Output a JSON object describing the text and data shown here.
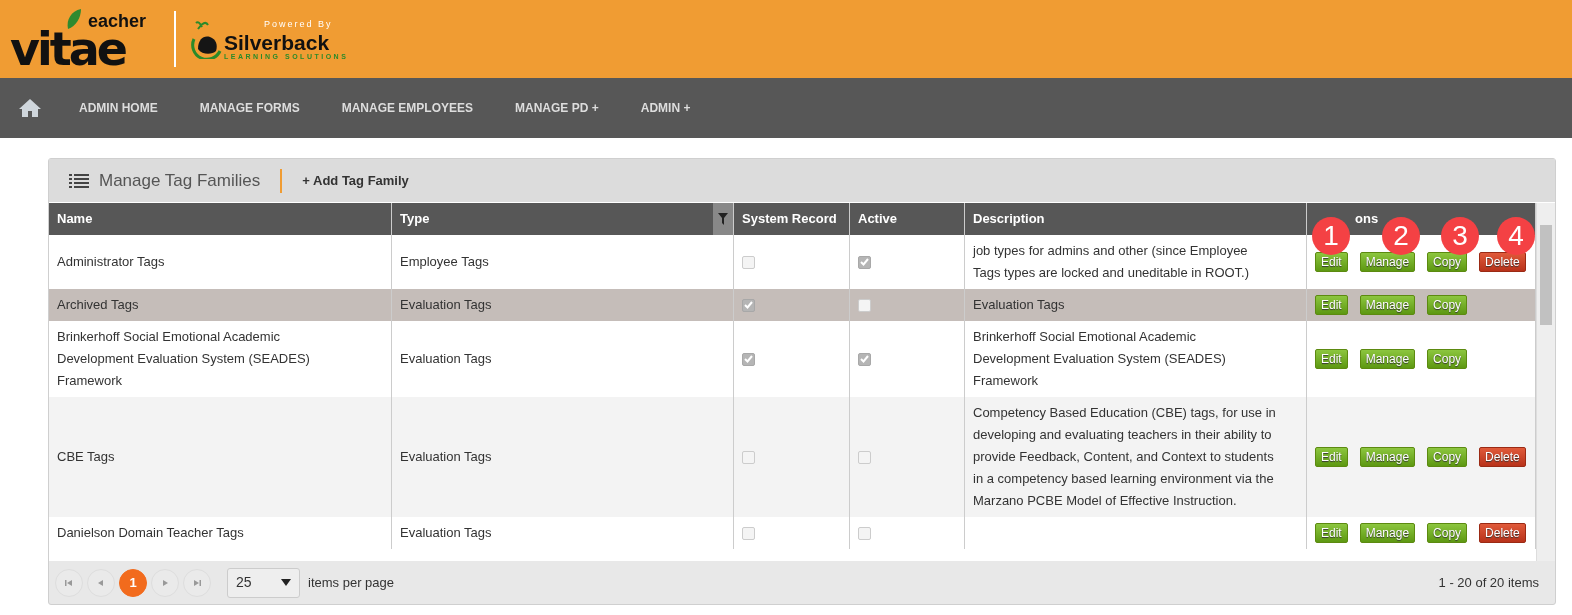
{
  "logo": {
    "top": "eacher",
    "main": "vitae",
    "powered_by": "Powered By",
    "brand": "Silverback",
    "tagline": "LEARNING SOLUTIONS"
  },
  "nav": [
    {
      "label": "ADMIN HOME"
    },
    {
      "label": "MANAGE FORMS"
    },
    {
      "label": "MANAGE EMPLOYEES"
    },
    {
      "label": "MANAGE PD +"
    },
    {
      "label": "ADMIN +"
    }
  ],
  "panel": {
    "title": "Manage Tag Families",
    "add_button": "+ Add Tag Family"
  },
  "table": {
    "columns": [
      "Name",
      "Type",
      "System Record",
      "Active",
      "Description",
      "ons"
    ],
    "rows": [
      {
        "name": "Administrator Tags",
        "type": "Employee Tags",
        "system_record": false,
        "active": true,
        "description": "job types for admins and other (since Employee Tags types are locked and uneditable in ROOT.)",
        "selected": false,
        "actions": [
          "Edit",
          "Manage",
          "Copy",
          "Delete"
        ]
      },
      {
        "name": "Archived Tags",
        "type": "Evaluation Tags",
        "system_record": true,
        "active": false,
        "description": "Evaluation Tags",
        "selected": true,
        "actions": [
          "Edit",
          "Manage",
          "Copy"
        ]
      },
      {
        "name": "Brinkerhoff Social Emotional Academic Development Evaluation System (SEADES) Framework",
        "type": "Evaluation Tags",
        "system_record": true,
        "active": true,
        "description": "Brinkerhoff Social Emotional Academic Development Evaluation System (SEADES) Framework",
        "selected": false,
        "actions": [
          "Edit",
          "Manage",
          "Copy"
        ]
      },
      {
        "name": "CBE Tags",
        "type": "Evaluation Tags",
        "system_record": false,
        "active": false,
        "description": "Competency Based Education (CBE) tags, for use in developing and evaluating teachers in their ability to provide Feedback, Content, and Context to students in a competency based learning environment via the Marzano PCBE Model of Effective Instruction.",
        "selected": false,
        "actions": [
          "Edit",
          "Manage",
          "Copy",
          "Delete"
        ]
      },
      {
        "name": "Danielson Domain Teacher Tags",
        "type": "Evaluation Tags",
        "system_record": false,
        "active": false,
        "description": "",
        "selected": false,
        "actions": [
          "Edit",
          "Manage",
          "Copy",
          "Delete"
        ]
      }
    ]
  },
  "callouts": [
    "1",
    "2",
    "3",
    "4"
  ],
  "pager": {
    "pages": [
      {
        "label": "1",
        "selected": true
      }
    ],
    "page_size": "25",
    "page_size_label": "items per page",
    "summary": "1 - 20 of 20 items"
  }
}
